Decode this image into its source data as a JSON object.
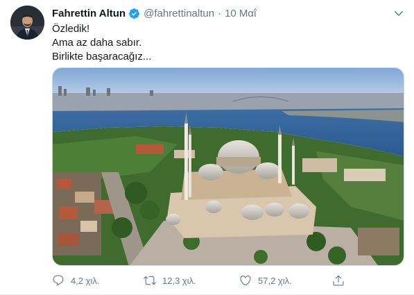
{
  "tweet": {
    "author_name": "Fahrettin Altun",
    "author_handle": "@fahrettinaltun",
    "separator": "·",
    "date": "10 Μαΐ",
    "text_lines": [
      "Özledik!",
      "Ama az daha sabır.",
      "Birlikte başaracağız..."
    ],
    "verified_color": "#1da1f2"
  },
  "media": {
    "icon": "photo"
  },
  "actions": {
    "reply_count": "4,2 χιλ.",
    "retweet_count": "12,3 χιλ.",
    "like_count": "57,2 χιλ."
  },
  "icons": {
    "verified": "verified-badge-icon",
    "caret": "chevron-down-icon",
    "reply": "reply-icon",
    "retweet": "retweet-icon",
    "like": "heart-icon",
    "share": "share-icon"
  }
}
